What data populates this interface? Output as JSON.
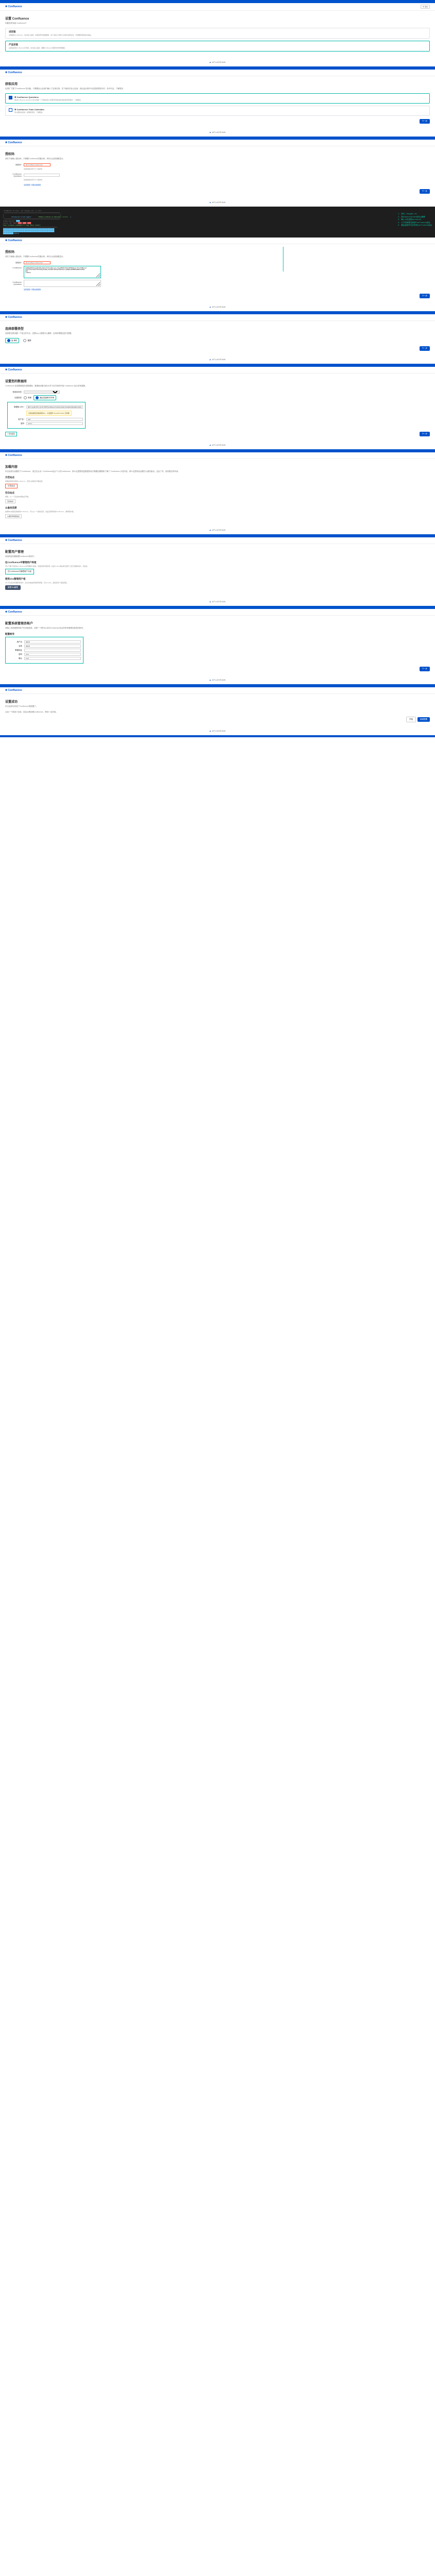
{
  "brand": "Confluence",
  "atlassian": "ATLASSIAN",
  "lang_btn": "中 语言",
  "s1": {
    "title": "设置 Confluence",
    "sub": "你要怎样安装 Confluence？",
    "trial": {
      "t": "试安装",
      "d": "试用着玩Confluence，也许会公会用，系统自带内置数据库，这个适合人员较少又或许试用试试，已经要安装的建议用品。"
    },
    "prod": {
      "t": "产品安装",
      "d": "设置链接到Confluence已存库，也许会公会用，需要Confluence保存时时刻刻数据。"
    }
  },
  "s2": {
    "title": "获取应用",
    "sub": "应用扩了展了Confluence 的功能，只需要会公会用们最小了应用试用，在下面选中会公会用，然后由出现许可证密钥的提示时，央许可证。了解更多。",
    "q": {
      "t": " Confluence Questions",
      "d": "通过Confluence Questions可以创建一个问答社区以方便问问约的进行答的和专家提升，了解更多。"
    },
    "tc": {
      "t": " Confluence Team Calendars",
      "d": "何以团约的活动，权限和项目，了解更多。"
    }
  },
  "s3": {
    "title": "授权码",
    "sub": "请在下面输入摄仪码，只需要Confluence的摄仪码，转向公会用钥匙显示。",
    "field_label": "授权码*",
    "placeholder": "B1VT-M5G1-UX32-1234",
    "helper": "应用的摄仪码于几个提时时",
    "qlabel": "Confluence Questions",
    "link1": "没有密钥？获取试用密钥"
  },
  "terminal": {
    "banner": "Atlassian Crack Agent",
    "ver": "https://zhile.io Version: 1.2.3",
    "lic_line": "Your license code(Don't copy this line!)",
    "lic_text": "AAABmg0ODAoPeJyNkt9PwjAQx9/3VzTxSZOx",
    "callouts": [
      "1. 执行./keygen.sh",
      "2. 到Organization也可以随便",
      "3. 输入id生成的serverId",
      "4. 以下的就是注册到Confluence后台",
      "5. 最后复制许可证号到Confluence后台"
    ]
  },
  "s3b": {
    "ta_val": "AAABmg0ODAoPeJyNkt9PwjAQx9/3VzTxSZOxlqJj+lhgomHMZIzEJ4OxdKPZWmha4/73tjCHxMbLLe3\nSt3e7+9x11SdXF3T8itHsQjdGuRmjcFKJHMYxXRnGqVs5Wo5Zjzv/WEgBLs9UMMPUAmRHR+1005pl\nNJM\n==X02im"
  },
  "s4": {
    "title": "选择部署类型",
    "sub": "选择是否是设置一个独立的节点，还是key入数据中心集群，应用将根据这进行配置。",
    "r1": "独 单机",
    "r2": "集群"
  },
  "next": "下一步",
  "back": "后退",
  "s5": {
    "title": "设置您的数据库",
    "sub": "Confluence 会将数据保存进数据库。数据库设置 相关大学习在字段的外部 Confluence 站点非常重要。",
    "type_label": "数据库类型",
    "type_val": "MySQL",
    "setup_label": "设置类型",
    "r_simple": "简单",
    "r_conn": "通过连接串字符串",
    "url_label": "数据库 URL*",
    "url_val": "jdbc:mysql://10.4.10.11:3307/confluence?useUnicode=true&characterEncoding=utf8",
    "url_hint": "这里是要连接数据库的url，并且要带 &useSSL=false 怎样看",
    "user_label": "用户名*",
    "user_val": "root",
    "pwd_label": "密码",
    "test_btn": "测试连接"
  },
  "s6": {
    "title": "加载内容",
    "intro": "你已经成功设置好了Confluence，或正在从另一Confluence站点个人的Confluence，那么这里是恢复数据的地方需要如果是新了解了 Confluence 示范内容，那么这里将会设置它以做初始化，这会了内，依然是这样本身。",
    "ex": {
      "t": "示范站点",
      "d": "如果是你首次使用Confluence，应该从的建议示看设置。",
      "btn": "示范站点"
    },
    "em": {
      "t": "空白站点",
      "d": "或者，从一个空白的内容站点开始。",
      "btn": "空白站点"
    },
    "bk": {
      "t": "从备份还原",
      "d": "如果你以前就应用使用Confluence，可以从一个备份还原，这是迁移现有的Confluence，推荐使内容。",
      "btn": "从备份中恢复站点"
    }
  },
  "s7": {
    "title": "配置用户管理",
    "sub": "请选择如何要管理Confluence的用户。",
    "h1": "在Confluence中管理用户和组",
    "d1": "可以下面下直接在Confluence中管理用户和组，另连接到外部目录—比如Crowd 或在体已经有了自己管理的用户，然后在",
    "btn1": "在Confluence中管理用户与组",
    "h2": "使用Jira管理用户组",
    "d2": "Jira 可以集中管理所有用户，这允许或由外部目录管理，可以Crowd，连接到该个连接配置。",
    "btn2": "管理Jira管理"
  },
  "s8": {
    "title": "配置系统管理员帐户",
    "sub": "请输入系统管理员帐户的详细信息，这是一个是可以访问Confluence站点的所有管理功能的的帐号。",
    "h": "配置帐号",
    "f_user": "用户名",
    "v_user": "admin",
    "f_name": "名称",
    "v_name": "admin",
    "f_email": "邮箱地址",
    "f_pwd": "密码",
    "f_conf": "确认"
  },
  "s9": {
    "title": "设置成功",
    "sub": "你已经成功完成了Confluence的配置了。",
    "d": "点连一个按选了应用，将会迁移该确Confluence，等待一会完成。",
    "go": "开始",
    "more": "继续配置"
  }
}
